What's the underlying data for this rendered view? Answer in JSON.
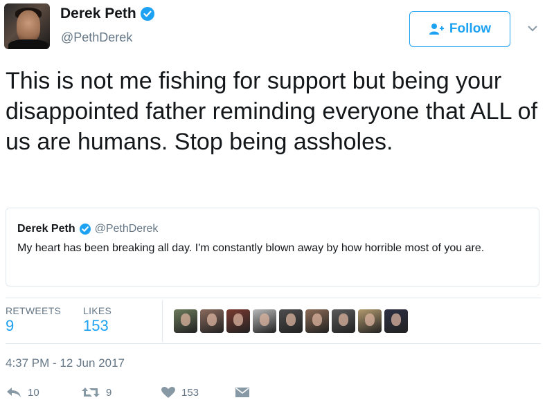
{
  "author": {
    "name": "Derek Peth",
    "handle": "@PethDerek",
    "verified_icon": "verified-badge-icon"
  },
  "follow_button": {
    "label": "Follow",
    "icon": "add-user-icon"
  },
  "menu_caret": {
    "icon": "chevron-down-icon"
  },
  "tweet": {
    "text": "This is not me fishing for support but being your disappointed father reminding everyone that ALL of us are humans. Stop being assholes."
  },
  "quoted_tweet": {
    "name": "Derek Peth",
    "handle": "@PethDerek",
    "text": "My heart has been breaking all day. I'm constantly blown away by how horrible most of you are."
  },
  "stats": {
    "retweets_label": "RETWEETS",
    "retweets_value": "9",
    "likes_label": "LIKES",
    "likes_value": "153"
  },
  "likers": [
    {
      "color": "#6b7a5a"
    },
    {
      "color": "#8a6a5c"
    },
    {
      "color": "#7a3a30"
    },
    {
      "color": "#b8b8b8"
    },
    {
      "color": "#4d4d4d"
    },
    {
      "color": "#8c6b55"
    },
    {
      "color": "#5a5a5a"
    },
    {
      "color": "#b39a6e"
    },
    {
      "color": "#2e3044"
    }
  ],
  "timestamp": "4:37 PM - 12 Jun 2017",
  "actions": {
    "reply": {
      "icon": "reply-icon",
      "count": "10"
    },
    "retweet": {
      "icon": "retweet-icon",
      "count": "9"
    },
    "like": {
      "icon": "heart-icon",
      "count": "153"
    },
    "dm": {
      "icon": "direct-message-icon"
    }
  },
  "colors": {
    "accent": "#1da1f2",
    "text": "#14171a",
    "muted": "#657786",
    "border": "#e1e8ed"
  }
}
